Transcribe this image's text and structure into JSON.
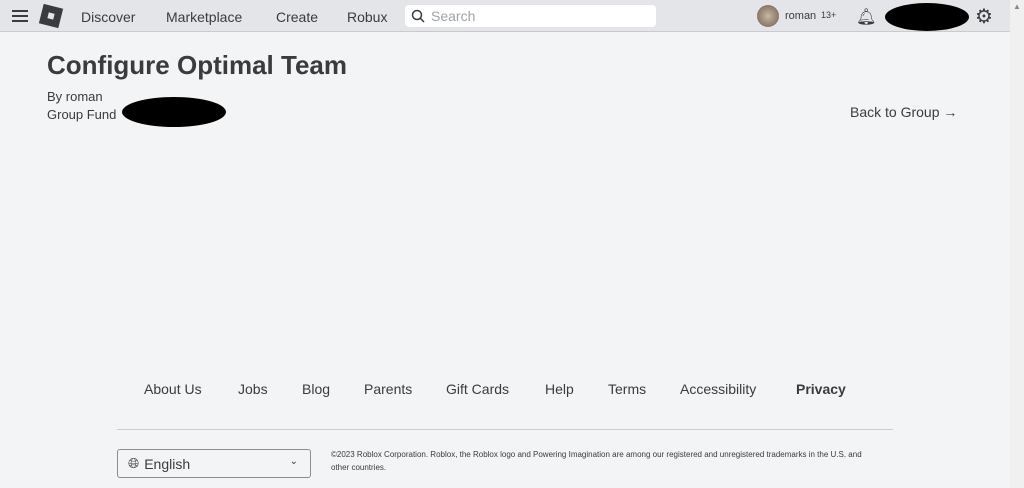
{
  "nav": {
    "discover": "Discover",
    "marketplace": "Marketplace",
    "create": "Create",
    "robux": "Robux",
    "search_placeholder": "Search",
    "username": "roman",
    "age": "13+"
  },
  "page": {
    "title": "Configure Optimal Team",
    "by": "By roman",
    "group": "Group Fund",
    "back": "Back to Group →"
  },
  "footer": {
    "links": [
      "About Us",
      "Jobs",
      "Blog",
      "Parents",
      "Gift Cards",
      "Help",
      "Terms",
      "Accessibility",
      "Privacy"
    ],
    "language": "English",
    "copyright": "©2023 Roblox Corporation. Roblox, the Roblox logo and Powering Imagination are among our registered and unregistered trademarks in the U.S. and other countries."
  }
}
